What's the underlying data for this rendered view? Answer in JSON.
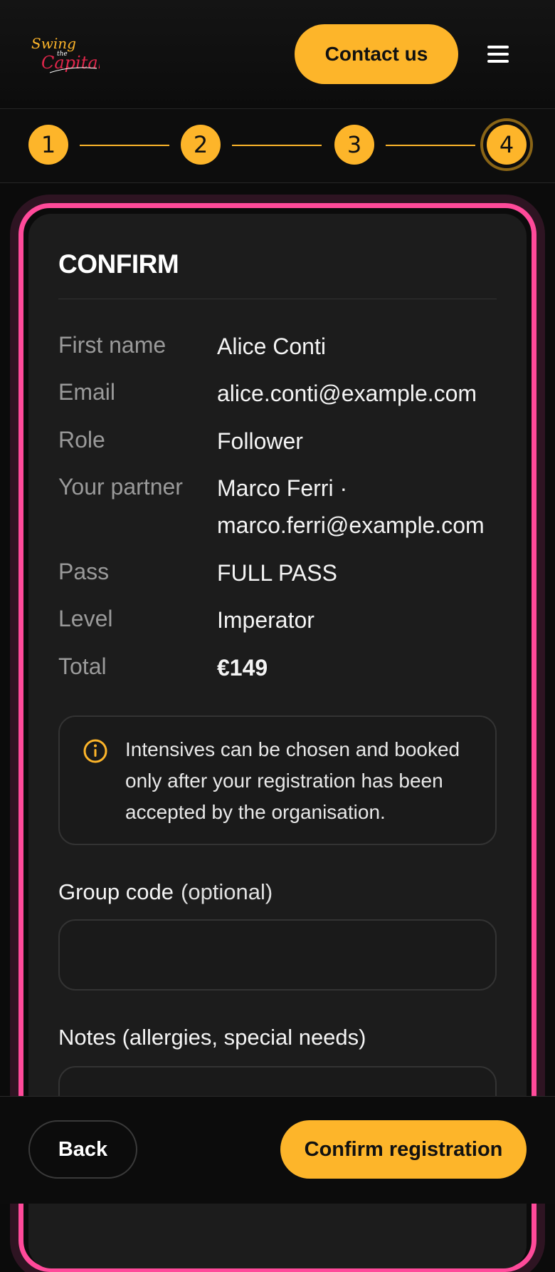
{
  "header": {
    "logo_alt": "Swing the Capital",
    "contact_label": "Contact us",
    "menu_icon": "hamburger-menu-icon"
  },
  "stepper": {
    "steps": [
      "1",
      "2",
      "3",
      "4"
    ],
    "current_step": 4
  },
  "confirm": {
    "title": "CONFIRM",
    "rows": [
      {
        "label": "First name",
        "value": "Alice Conti"
      },
      {
        "label": "Email",
        "value": "alice.conti@example.com"
      },
      {
        "label": "Role",
        "value": "Follower"
      },
      {
        "label": "Your partner",
        "value": "Marco Ferri · marco.ferri@example.com"
      },
      {
        "label": "Pass",
        "value": "FULL PASS"
      },
      {
        "label": "Level",
        "value": "Imperator"
      },
      {
        "label": "Total",
        "value": "€149"
      }
    ],
    "info": {
      "icon": "info-circle-icon",
      "text": "Intensives can be chosen and booked only after your registration has been accepted by the organisation."
    },
    "group_code": {
      "label": "Group code",
      "optional": "(optional)",
      "value": ""
    },
    "notes": {
      "label": "Notes (allergies, special needs)",
      "value": ""
    }
  },
  "footer": {
    "back_label": "Back",
    "confirm_label": "Confirm registration"
  },
  "colors": {
    "accent": "#fdb52a",
    "card_border": "#ff4a9a",
    "background": "#0b0b0b"
  }
}
